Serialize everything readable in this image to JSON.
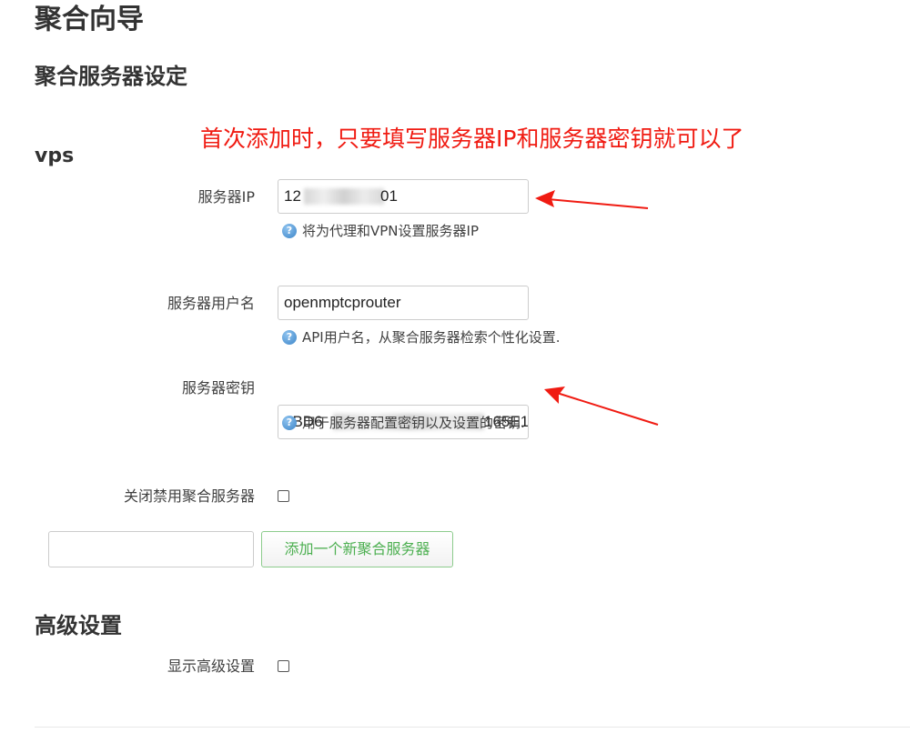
{
  "page": {
    "title": "聚合向导",
    "section_title": "聚合服务器设定",
    "subsection_title": "vps",
    "annotation": "首次添加时，只要填写服务器IP和服务器密钥就可以了",
    "annotation_color": "#f01b12"
  },
  "form": {
    "server_ip": {
      "label": "服务器IP",
      "value_start": "12",
      "value_end": "01",
      "hint": "将为代理和VPN设置服务器IP"
    },
    "server_username": {
      "label": "服务器用户名",
      "value": "openmptcprouter",
      "hint": "API用户名，从聚合服务器检索个性化设置."
    },
    "server_key": {
      "label": "服务器密钥",
      "value_start": "8BD6",
      "value_end": "165E1",
      "hint": "用于服务器配置密钥以及设置的密钥."
    },
    "disable_server": {
      "label": "关闭禁用聚合服务器",
      "checked": false
    },
    "add_server_button": "添加一个新聚合服务器",
    "new_server_name": ""
  },
  "advanced": {
    "title": "高级设置",
    "show_advanced": {
      "label": "显示高级设置",
      "checked": false
    }
  },
  "icons": {
    "help": "help-question-icon",
    "arrow": "red-arrow-annotation"
  },
  "colors": {
    "accent_green": "#4caf50",
    "help_blue": "#3d86c9",
    "arrow_red": "#f01b12"
  }
}
